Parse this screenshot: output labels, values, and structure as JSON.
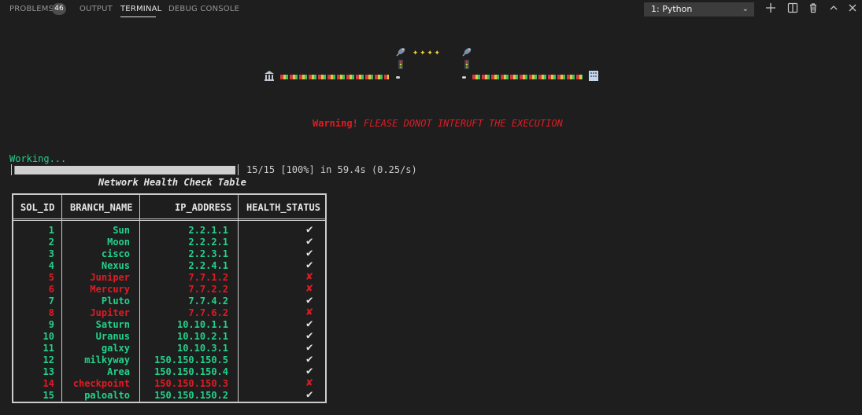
{
  "panel": {
    "tabs": [
      {
        "label": "PROBLEMS"
      },
      {
        "label": "OUTPUT"
      },
      {
        "label": "TERMINAL"
      },
      {
        "label": "DEBUG CONSOLE"
      }
    ],
    "problems_count": "46",
    "terminal_select": "1: Python",
    "icons": [
      "add-terminal-icon",
      "split-terminal-icon",
      "trash-icon",
      "chevron-up-icon",
      "close-icon"
    ]
  },
  "banner": {
    "stars": "✦✦✦✦"
  },
  "warning": {
    "label": "Warning!",
    "message": "FLEASE DONOT INTERUFT THE EXECUTION"
  },
  "progress": {
    "status": "Working...",
    "fraction": 1.0,
    "text": "15/15 [100%] in 59.4s (0.25/s)"
  },
  "table": {
    "title": "Network Health Check Table",
    "headers": [
      "SOL_ID",
      "BRANCH_NAME",
      "IP_ADDRESS",
      "HEALTH_STATUS"
    ],
    "rows": [
      {
        "id": "1",
        "branch": "Sun",
        "ip": "2.2.1.1",
        "status": "ok"
      },
      {
        "id": "2",
        "branch": "Moon",
        "ip": "2.2.2.1",
        "status": "ok"
      },
      {
        "id": "3",
        "branch": "cisco",
        "ip": "2.2.3.1",
        "status": "ok"
      },
      {
        "id": "4",
        "branch": "Nexus",
        "ip": "2.2.4.1",
        "status": "ok"
      },
      {
        "id": "5",
        "branch": "Juniper",
        "ip": "7.7.1.2",
        "status": "bad"
      },
      {
        "id": "6",
        "branch": "Mercury",
        "ip": "7.7.2.2",
        "status": "bad"
      },
      {
        "id": "7",
        "branch": "Pluto",
        "ip": "7.7.4.2",
        "status": "ok"
      },
      {
        "id": "8",
        "branch": "Jupiter",
        "ip": "7.7.6.2",
        "status": "bad"
      },
      {
        "id": "9",
        "branch": "Saturn",
        "ip": "10.10.1.1",
        "status": "ok"
      },
      {
        "id": "10",
        "branch": "Uranus",
        "ip": "10.10.2.1",
        "status": "ok"
      },
      {
        "id": "11",
        "branch": "galxy",
        "ip": "10.10.3.1",
        "status": "ok"
      },
      {
        "id": "12",
        "branch": "milkyway",
        "ip": "150.150.150.5",
        "status": "ok"
      },
      {
        "id": "13",
        "branch": "Area",
        "ip": "150.150.150.4",
        "status": "ok"
      },
      {
        "id": "14",
        "branch": "checkpoint",
        "ip": "150.150.150.3",
        "status": "bad"
      },
      {
        "id": "15",
        "branch": "paloalto",
        "ip": "150.150.150.2",
        "status": "ok"
      }
    ],
    "ok_mark": "✔",
    "bad_mark": "✘"
  },
  "colors": {
    "ok": "#23d18b",
    "bad": "#e01b24",
    "background": "#1e1e1e"
  }
}
